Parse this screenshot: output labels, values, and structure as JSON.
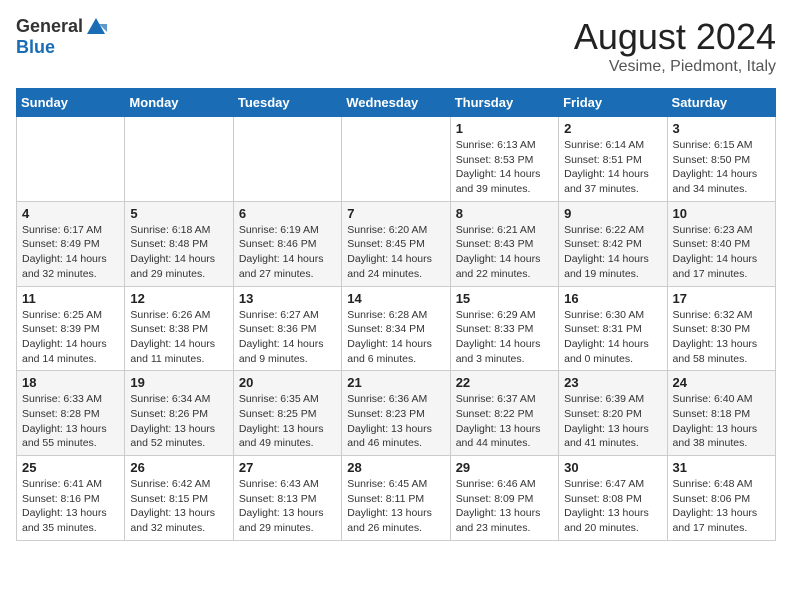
{
  "logo": {
    "general": "General",
    "blue": "Blue"
  },
  "title": "August 2024",
  "location": "Vesime, Piedmont, Italy",
  "weekdays": [
    "Sunday",
    "Monday",
    "Tuesday",
    "Wednesday",
    "Thursday",
    "Friday",
    "Saturday"
  ],
  "weeks": [
    [
      {
        "day": "",
        "info": ""
      },
      {
        "day": "",
        "info": ""
      },
      {
        "day": "",
        "info": ""
      },
      {
        "day": "",
        "info": ""
      },
      {
        "day": "1",
        "info": "Sunrise: 6:13 AM\nSunset: 8:53 PM\nDaylight: 14 hours\nand 39 minutes."
      },
      {
        "day": "2",
        "info": "Sunrise: 6:14 AM\nSunset: 8:51 PM\nDaylight: 14 hours\nand 37 minutes."
      },
      {
        "day": "3",
        "info": "Sunrise: 6:15 AM\nSunset: 8:50 PM\nDaylight: 14 hours\nand 34 minutes."
      }
    ],
    [
      {
        "day": "4",
        "info": "Sunrise: 6:17 AM\nSunset: 8:49 PM\nDaylight: 14 hours\nand 32 minutes."
      },
      {
        "day": "5",
        "info": "Sunrise: 6:18 AM\nSunset: 8:48 PM\nDaylight: 14 hours\nand 29 minutes."
      },
      {
        "day": "6",
        "info": "Sunrise: 6:19 AM\nSunset: 8:46 PM\nDaylight: 14 hours\nand 27 minutes."
      },
      {
        "day": "7",
        "info": "Sunrise: 6:20 AM\nSunset: 8:45 PM\nDaylight: 14 hours\nand 24 minutes."
      },
      {
        "day": "8",
        "info": "Sunrise: 6:21 AM\nSunset: 8:43 PM\nDaylight: 14 hours\nand 22 minutes."
      },
      {
        "day": "9",
        "info": "Sunrise: 6:22 AM\nSunset: 8:42 PM\nDaylight: 14 hours\nand 19 minutes."
      },
      {
        "day": "10",
        "info": "Sunrise: 6:23 AM\nSunset: 8:40 PM\nDaylight: 14 hours\nand 17 minutes."
      }
    ],
    [
      {
        "day": "11",
        "info": "Sunrise: 6:25 AM\nSunset: 8:39 PM\nDaylight: 14 hours\nand 14 minutes."
      },
      {
        "day": "12",
        "info": "Sunrise: 6:26 AM\nSunset: 8:38 PM\nDaylight: 14 hours\nand 11 minutes."
      },
      {
        "day": "13",
        "info": "Sunrise: 6:27 AM\nSunset: 8:36 PM\nDaylight: 14 hours\nand 9 minutes."
      },
      {
        "day": "14",
        "info": "Sunrise: 6:28 AM\nSunset: 8:34 PM\nDaylight: 14 hours\nand 6 minutes."
      },
      {
        "day": "15",
        "info": "Sunrise: 6:29 AM\nSunset: 8:33 PM\nDaylight: 14 hours\nand 3 minutes."
      },
      {
        "day": "16",
        "info": "Sunrise: 6:30 AM\nSunset: 8:31 PM\nDaylight: 14 hours\nand 0 minutes."
      },
      {
        "day": "17",
        "info": "Sunrise: 6:32 AM\nSunset: 8:30 PM\nDaylight: 13 hours\nand 58 minutes."
      }
    ],
    [
      {
        "day": "18",
        "info": "Sunrise: 6:33 AM\nSunset: 8:28 PM\nDaylight: 13 hours\nand 55 minutes."
      },
      {
        "day": "19",
        "info": "Sunrise: 6:34 AM\nSunset: 8:26 PM\nDaylight: 13 hours\nand 52 minutes."
      },
      {
        "day": "20",
        "info": "Sunrise: 6:35 AM\nSunset: 8:25 PM\nDaylight: 13 hours\nand 49 minutes."
      },
      {
        "day": "21",
        "info": "Sunrise: 6:36 AM\nSunset: 8:23 PM\nDaylight: 13 hours\nand 46 minutes."
      },
      {
        "day": "22",
        "info": "Sunrise: 6:37 AM\nSunset: 8:22 PM\nDaylight: 13 hours\nand 44 minutes."
      },
      {
        "day": "23",
        "info": "Sunrise: 6:39 AM\nSunset: 8:20 PM\nDaylight: 13 hours\nand 41 minutes."
      },
      {
        "day": "24",
        "info": "Sunrise: 6:40 AM\nSunset: 8:18 PM\nDaylight: 13 hours\nand 38 minutes."
      }
    ],
    [
      {
        "day": "25",
        "info": "Sunrise: 6:41 AM\nSunset: 8:16 PM\nDaylight: 13 hours\nand 35 minutes."
      },
      {
        "day": "26",
        "info": "Sunrise: 6:42 AM\nSunset: 8:15 PM\nDaylight: 13 hours\nand 32 minutes."
      },
      {
        "day": "27",
        "info": "Sunrise: 6:43 AM\nSunset: 8:13 PM\nDaylight: 13 hours\nand 29 minutes."
      },
      {
        "day": "28",
        "info": "Sunrise: 6:45 AM\nSunset: 8:11 PM\nDaylight: 13 hours\nand 26 minutes."
      },
      {
        "day": "29",
        "info": "Sunrise: 6:46 AM\nSunset: 8:09 PM\nDaylight: 13 hours\nand 23 minutes."
      },
      {
        "day": "30",
        "info": "Sunrise: 6:47 AM\nSunset: 8:08 PM\nDaylight: 13 hours\nand 20 minutes."
      },
      {
        "day": "31",
        "info": "Sunrise: 6:48 AM\nSunset: 8:06 PM\nDaylight: 13 hours\nand 17 minutes."
      }
    ]
  ]
}
